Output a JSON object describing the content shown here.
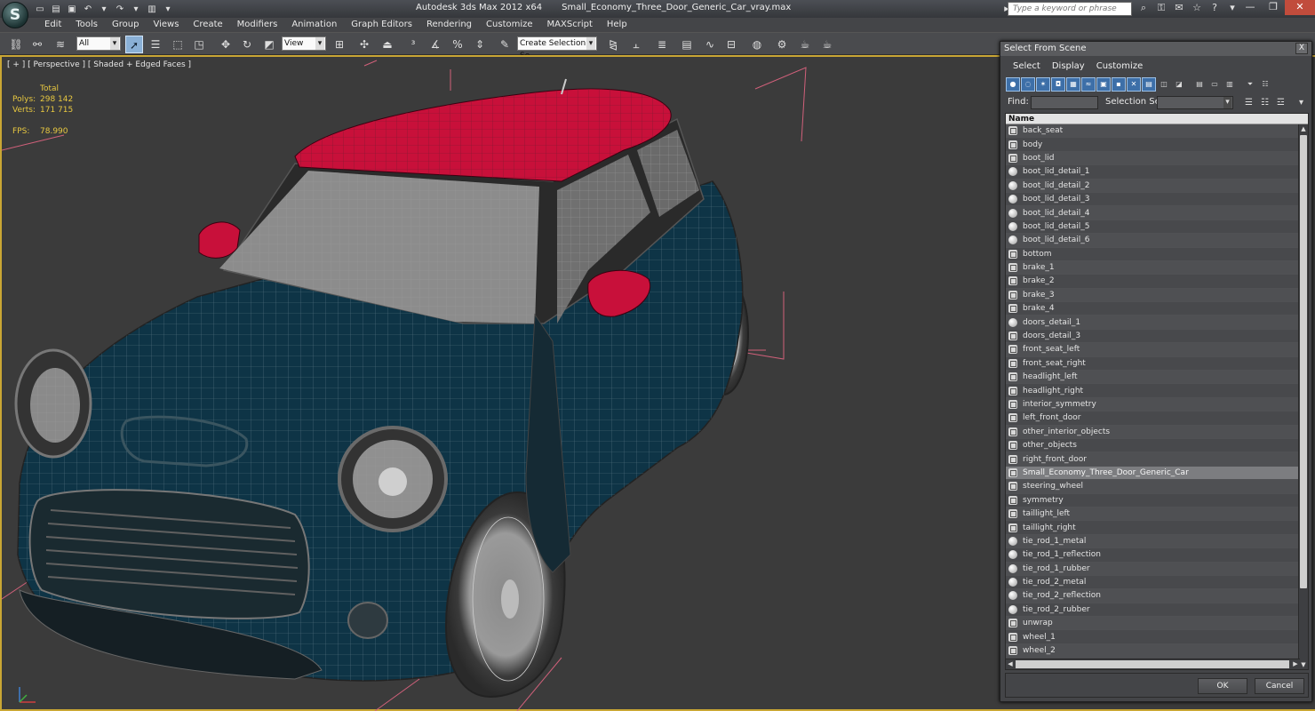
{
  "window": {
    "app_title": "Autodesk 3ds Max  2012 x64",
    "file_name": "Small_Economy_Three_Door_Generic_Car_vray.max",
    "search_placeholder": "Type a keyword or phrase",
    "logo": "S"
  },
  "menu": [
    "Edit",
    "Tools",
    "Group",
    "Views",
    "Create",
    "Modifiers",
    "Animation",
    "Graph Editors",
    "Rendering",
    "Customize",
    "MAXScript",
    "Help"
  ],
  "toolbar": {
    "selection_filter": "All",
    "reference_coord": "View",
    "named_selection": "Create Selection Se"
  },
  "viewport": {
    "label": "[ + ] [ Perspective ] [ Shaded + Edged Faces ]",
    "stats": {
      "total_label": "Total",
      "polys_label": "Polys:",
      "polys_value": "298 142",
      "verts_label": "Verts:",
      "verts_value": "171 715",
      "fps_label": "FPS:",
      "fps_value": "78.990"
    },
    "colors": {
      "car_body": "#0e3446",
      "roof_and_mirrors": "#c8103a",
      "wireframe": "#6a7f88",
      "bounding_box": "#d0607a",
      "active_border": "#c9a634"
    }
  },
  "dialog": {
    "title": "Select From Scene",
    "close": "X",
    "menu": [
      "Select",
      "Display",
      "Customize"
    ],
    "find_label": "Find:",
    "find_value": "",
    "selection_set_label": "Selection Set:",
    "column_header": "Name",
    "ok_label": "OK",
    "cancel_label": "Cancel",
    "objects": [
      {
        "name": "back_seat",
        "icon": "mesh"
      },
      {
        "name": "body",
        "icon": "mesh"
      },
      {
        "name": "boot_lid",
        "icon": "mesh"
      },
      {
        "name": "boot_lid_detail_1",
        "icon": "sphere"
      },
      {
        "name": "boot_lid_detail_2",
        "icon": "sphere"
      },
      {
        "name": "boot_lid_detail_3",
        "icon": "sphere"
      },
      {
        "name": "boot_lid_detail_4",
        "icon": "sphere"
      },
      {
        "name": "boot_lid_detail_5",
        "icon": "sphere"
      },
      {
        "name": "boot_lid_detail_6",
        "icon": "sphere"
      },
      {
        "name": "bottom",
        "icon": "mesh"
      },
      {
        "name": "brake_1",
        "icon": "mesh"
      },
      {
        "name": "brake_2",
        "icon": "mesh"
      },
      {
        "name": "brake_3",
        "icon": "mesh"
      },
      {
        "name": "brake_4",
        "icon": "mesh"
      },
      {
        "name": "doors_detail_1",
        "icon": "sphere"
      },
      {
        "name": "doors_detail_3",
        "icon": "mesh"
      },
      {
        "name": "front_seat_left",
        "icon": "mesh"
      },
      {
        "name": "front_seat_right",
        "icon": "mesh"
      },
      {
        "name": "headlight_left",
        "icon": "mesh"
      },
      {
        "name": "headlight_right",
        "icon": "mesh"
      },
      {
        "name": "interior_symmetry",
        "icon": "mesh"
      },
      {
        "name": "left_front_door",
        "icon": "mesh"
      },
      {
        "name": "other_interior_objects",
        "icon": "mesh"
      },
      {
        "name": "other_objects",
        "icon": "mesh"
      },
      {
        "name": "right_front_door",
        "icon": "mesh"
      },
      {
        "name": "Small_Economy_Three_Door_Generic_Car",
        "icon": "mesh",
        "selected": true
      },
      {
        "name": "steering_wheel",
        "icon": "mesh"
      },
      {
        "name": "symmetry",
        "icon": "mesh"
      },
      {
        "name": "taillight_left",
        "icon": "mesh"
      },
      {
        "name": "taillight_right",
        "icon": "mesh"
      },
      {
        "name": "tie_rod_1_metal",
        "icon": "sphere"
      },
      {
        "name": "tie_rod_1_reflection",
        "icon": "sphere"
      },
      {
        "name": "tie_rod_1_rubber",
        "icon": "sphere"
      },
      {
        "name": "tie_rod_2_metal",
        "icon": "sphere"
      },
      {
        "name": "tie_rod_2_reflection",
        "icon": "sphere"
      },
      {
        "name": "tie_rod_2_rubber",
        "icon": "sphere"
      },
      {
        "name": "unwrap",
        "icon": "mesh"
      },
      {
        "name": "wheel_1",
        "icon": "mesh"
      },
      {
        "name": "wheel_2",
        "icon": "mesh"
      }
    ]
  }
}
